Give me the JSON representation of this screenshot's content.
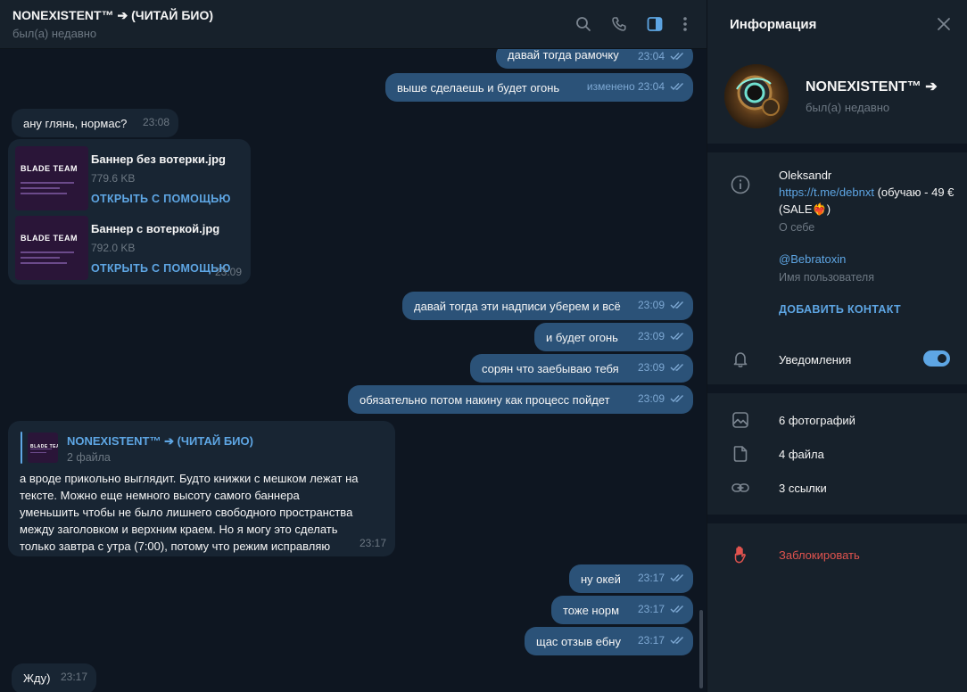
{
  "chat_header": {
    "title": "NONEXISTENT™ ➔ (ЧИТАЙ БИО)",
    "status": "был(а) недавно"
  },
  "messages": [
    {
      "dir": "out",
      "text": "давай тогда рамочку",
      "time": "23:04"
    },
    {
      "dir": "out",
      "text": "выше сделаешь и будет огонь",
      "time": "изменено 23:04"
    },
    {
      "dir": "in",
      "text": "ану глянь, нормас?",
      "time": "23:08"
    },
    {
      "dir": "in",
      "files": [
        {
          "thumb_label": "BLADE TEAM",
          "name": "Баннер без вотерки.jpg",
          "size": "779.6 KB",
          "action": "ОТКРЫТЬ С ПОМОЩЬЮ"
        },
        {
          "thumb_label": "BLADE TEAM",
          "name": "Баннер с вотеркой.jpg",
          "size": "792.0 KB",
          "action": "ОТКРЫТЬ С ПОМОЩЬЮ"
        }
      ],
      "time": "23:09"
    },
    {
      "dir": "out",
      "text": "давай тогда эти надписи уберем и всё",
      "time": "23:09"
    },
    {
      "dir": "out",
      "text": "и будет огонь",
      "time": "23:09"
    },
    {
      "dir": "out",
      "text": "сорян что заебываю тебя",
      "time": "23:09"
    },
    {
      "dir": "out",
      "text": "обязательно потом накину как процесс пойдет",
      "time": "23:09"
    },
    {
      "dir": "in",
      "reply": {
        "thumb_label": "BLADE TEAM",
        "name": "NONEXISTENT™ ➔ (ЧИТАЙ БИО)",
        "sub": "2 файла"
      },
      "lines": [
        "а вроде прикольно выглядит. Будто книжки с мешком лежат на",
        "тексте. Можно еще немного высоту самого баннера",
        "уменьшить чтобы не было лишнего свободного пространства",
        "между заголовком и верхним краем. Но я могу это сделать",
        "только завтра с утра (7:00), потому что режим исправляю"
      ],
      "time": "23:17"
    },
    {
      "dir": "out",
      "text": "ну окей",
      "time": "23:17"
    },
    {
      "dir": "out",
      "text": "тоже норм",
      "time": "23:17"
    },
    {
      "dir": "out",
      "text": "щас отзыв ебну",
      "time": "23:17"
    },
    {
      "dir": "in",
      "text": "Жду)",
      "time": "23:17"
    }
  ],
  "info_panel": {
    "title": "Информация",
    "profile_name": "NONEXISTENT™ ➔",
    "profile_status": "был(а) недавно",
    "bio_text": "Oleksandr",
    "bio_link": "https://t.me/debnxt",
    "bio_rest": " (обучаю - 49 € (SALE❤️‍🔥)",
    "bio_label": "О себе",
    "username": "@Bebratoxin",
    "username_label": "Имя пользователя",
    "add_contact": "ДОБАВИТЬ КОНТАКТ",
    "notifications": "Уведомления",
    "notifications_on": true,
    "photos": "6 фотографий",
    "files": "4 файла",
    "links": "3 ссылки",
    "block": "Заблокировать"
  },
  "colors": {
    "accent": "#5ea6e4",
    "bubble_out": "#2b5278",
    "bubble_in": "#182533",
    "danger": "#e0534e"
  }
}
